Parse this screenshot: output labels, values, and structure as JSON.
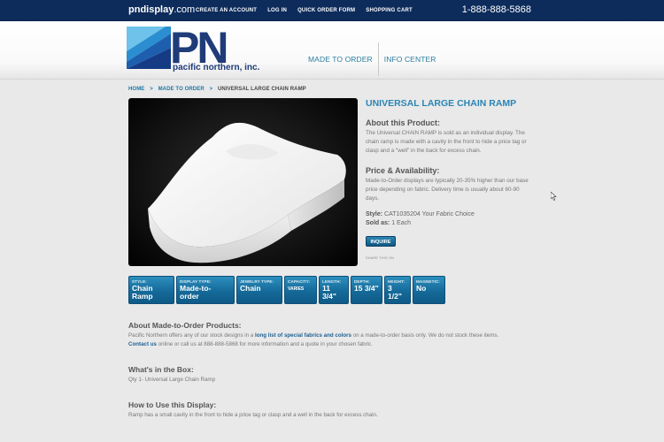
{
  "topbar": {
    "site_bold": "pndisplay",
    "site_tail": ".com",
    "nav": [
      "CREATE AN ACCOUNT",
      "LOG IN",
      "QUICK ORDER FORM",
      "SHOPPING CART"
    ],
    "phone": "1-888-888-5868"
  },
  "logo": {
    "letters": "PN",
    "tagline": "pacific northern, inc."
  },
  "main_nav": [
    "MADE TO ORDER",
    "INFO CENTER"
  ],
  "breadcrumb": [
    "HOME",
    ">",
    "MADE TO ORDER",
    ">",
    "UNIVERSAL LARGE CHAIN RAMP"
  ],
  "product": {
    "title": "UNIVERSAL LARGE CHAIN RAMP",
    "about_heading": "About this Product:",
    "about_text": "The Universal CHAIN RAMP is sold as an individual display. The chain ramp is made with a cavity in the front to hide a price tag or clasp and a \"well\" in the back for excess chain.",
    "price_heading": "Price & Availability:",
    "price_text": "Made-to-Order displays are typically 20-35% higher than our base price depending on fabric. Delivery time is usually about 60-90 days.",
    "style_label": "Style:",
    "style_value": "CAT1035204 Your Fabric Choice",
    "sold_label": "Sold as:",
    "sold_value": "1 Each",
    "inquire_label": "INQUIRE",
    "share_label": "SHARE THIS ON"
  },
  "specs": [
    {
      "label": "STYLE:",
      "value": "Chain Ramp"
    },
    {
      "label": "DISPLAY TYPE:",
      "value": "Made-to-order"
    },
    {
      "label": "JEWELRY TYPE:",
      "value": "Chain"
    },
    {
      "label": "CAPACITY:",
      "value": "VARIES"
    },
    {
      "label": "LENGTH:",
      "value": "11 3/4\""
    },
    {
      "label": "DEPTH:",
      "value": "15 3/4\""
    },
    {
      "label": "HEIGHT:",
      "value": "3 1/2\""
    },
    {
      "label": "MAGNETIC:",
      "value": "No"
    }
  ],
  "about_mto": {
    "heading": "About Made-to-Order Products:",
    "text_a": "Pacific Northern offers any of our stock designs in a ",
    "link_fabrics": "long list of special fabrics and colors",
    "text_b": " on a made-to-order basis only. We do not stock these items.",
    "link_contact": "Contact us",
    "text_c": " online or call us at 888-888-5868 for more information and a quote in your chosen fabric."
  },
  "in_box": {
    "heading": "What's in the Box:",
    "text": "Qty 1- Universal Large Chain Ramp"
  },
  "how_to": {
    "heading": "How to Use this Display:",
    "text": "Ramp has a small cavity in the front to hide a price tag or clasp and a well in the back for excess chain."
  },
  "colors": {
    "topbar": "#0d2c5c",
    "accent": "#2a85b5",
    "tile": "#156a99"
  }
}
